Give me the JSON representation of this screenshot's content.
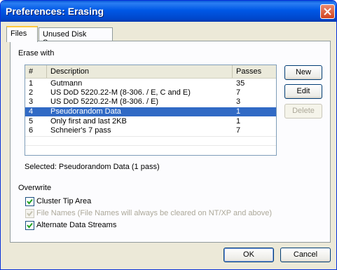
{
  "window": {
    "title": "Preferences: Erasing"
  },
  "tabs": [
    {
      "label": "Files",
      "active": true
    },
    {
      "label": "Unused Disk Space",
      "active": false
    }
  ],
  "erase_with": {
    "group_label": "Erase with",
    "columns": [
      "#",
      "Description",
      "Passes"
    ],
    "rows": [
      {
        "num": "1",
        "description": "Gutmann",
        "passes": "35"
      },
      {
        "num": "2",
        "description": "US DoD 5220.22-M (8-306. / E, C and E)",
        "passes": "7"
      },
      {
        "num": "3",
        "description": "US DoD 5220.22-M (8-306. / E)",
        "passes": "3"
      },
      {
        "num": "4",
        "description": "Pseudorandom Data",
        "passes": "1"
      },
      {
        "num": "5",
        "description": "Only first and last 2KB",
        "passes": "1"
      },
      {
        "num": "6",
        "description": "Schneier's 7 pass",
        "passes": "7"
      }
    ],
    "selected_row": "4",
    "selected_text": "Selected: Pseudorandom Data (1 pass)"
  },
  "side_buttons": {
    "new": "New",
    "edit": "Edit",
    "delete": "Delete"
  },
  "overwrite": {
    "group_label": "Overwrite",
    "cluster_tip": {
      "label": "Cluster Tip Area",
      "checked": true,
      "enabled": true
    },
    "file_names": {
      "label": "File Names (File Names will always be cleared on NT/XP and above)",
      "checked": true,
      "enabled": false
    },
    "alt_streams": {
      "label": "Alternate Data Streams",
      "checked": true,
      "enabled": true
    }
  },
  "footer": {
    "ok": "OK",
    "cancel": "Cancel"
  },
  "colors": {
    "title_bar": "#0058e6",
    "selection": "#316ac5",
    "dialog_bg": "#ece9d8"
  }
}
